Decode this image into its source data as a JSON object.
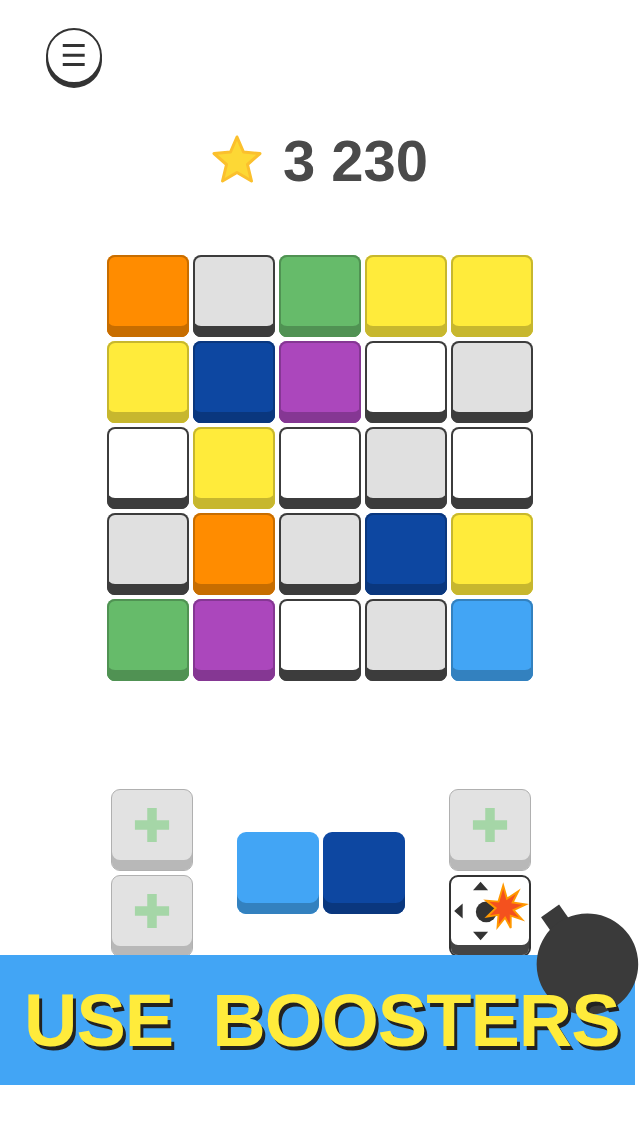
{
  "menu_button": "☰",
  "score": {
    "value": "3 230"
  },
  "board": [
    [
      {
        "color": "#ff8c00"
      },
      {
        "color": "#e0e0e0"
      },
      {
        "color": "#66bb6a"
      },
      {
        "color": "#ffeb3b"
      },
      {
        "color": "#ffeb3b"
      }
    ],
    [
      {
        "color": "#ffeb3b"
      },
      {
        "color": "#0d47a1"
      },
      {
        "color": "#ab47bc"
      },
      {
        "color": "#ffffff"
      },
      {
        "color": "#e0e0e0"
      }
    ],
    [
      {
        "color": "#ffffff"
      },
      {
        "color": "#ffeb3b"
      },
      {
        "color": "#ffffff"
      },
      {
        "color": "#e0e0e0"
      },
      {
        "color": "#ffffff"
      }
    ],
    [
      {
        "color": "#e0e0e0"
      },
      {
        "color": "#ff8c00"
      },
      {
        "color": "#e0e0e0"
      },
      {
        "color": "#0d47a1"
      },
      {
        "color": "#ffeb3b"
      }
    ],
    [
      {
        "color": "#66bb6a"
      },
      {
        "color": "#ab47bc"
      },
      {
        "color": "#ffffff"
      },
      {
        "color": "#e0e0e0"
      },
      {
        "color": "#42a5f5"
      }
    ]
  ],
  "piece": [
    {
      "color": "#42a5f5"
    },
    {
      "color": "#0d47a1"
    }
  ],
  "boosters_left": [
    {
      "kind": "empty"
    },
    {
      "kind": "empty"
    }
  ],
  "boosters_right": [
    {
      "kind": "empty"
    },
    {
      "kind": "bomb"
    }
  ],
  "banner": {
    "text": "USE  BOOSTERS"
  }
}
